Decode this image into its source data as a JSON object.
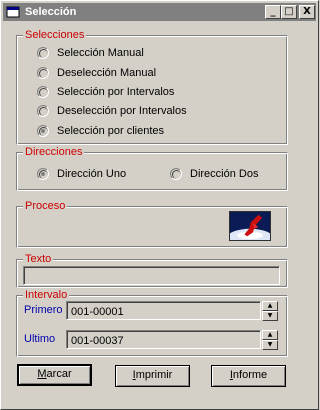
{
  "window": {
    "title": "Selección"
  },
  "titlebar": {
    "minimize": "_",
    "maximize": "□",
    "close": "X"
  },
  "selecciones": {
    "legend": "Selecciones",
    "options": [
      {
        "label": "Selección Manual",
        "checked": false
      },
      {
        "label": "Deselección Manual",
        "checked": false
      },
      {
        "label": "Selección por Intervalos",
        "checked": false
      },
      {
        "label": "Deselección por Intervalos",
        "checked": false
      },
      {
        "label": "Selección por clientes",
        "checked": true
      }
    ]
  },
  "direcciones": {
    "legend": "Direcciones",
    "options": [
      {
        "label": "Dirección Uno",
        "checked": true
      },
      {
        "label": "Dirección Dos",
        "checked": false
      }
    ]
  },
  "proceso": {
    "legend": "Proceso"
  },
  "texto": {
    "legend": "Texto",
    "value": ""
  },
  "intervalo": {
    "legend": "Intervalo",
    "primero_label": "Primero",
    "primero_value": "001-00001",
    "ultimo_label": "Ultimo",
    "ultimo_value": "001-00037"
  },
  "buttons": {
    "marcar": {
      "first": "M",
      "rest": "arcar"
    },
    "imprimir": {
      "first": "I",
      "rest": "mprimir"
    },
    "informe": {
      "first": "I",
      "rest": "nforme"
    }
  },
  "colors": {
    "legend": "#cc0000",
    "interval_label": "#0000aa",
    "face": "#d4d0c8"
  }
}
